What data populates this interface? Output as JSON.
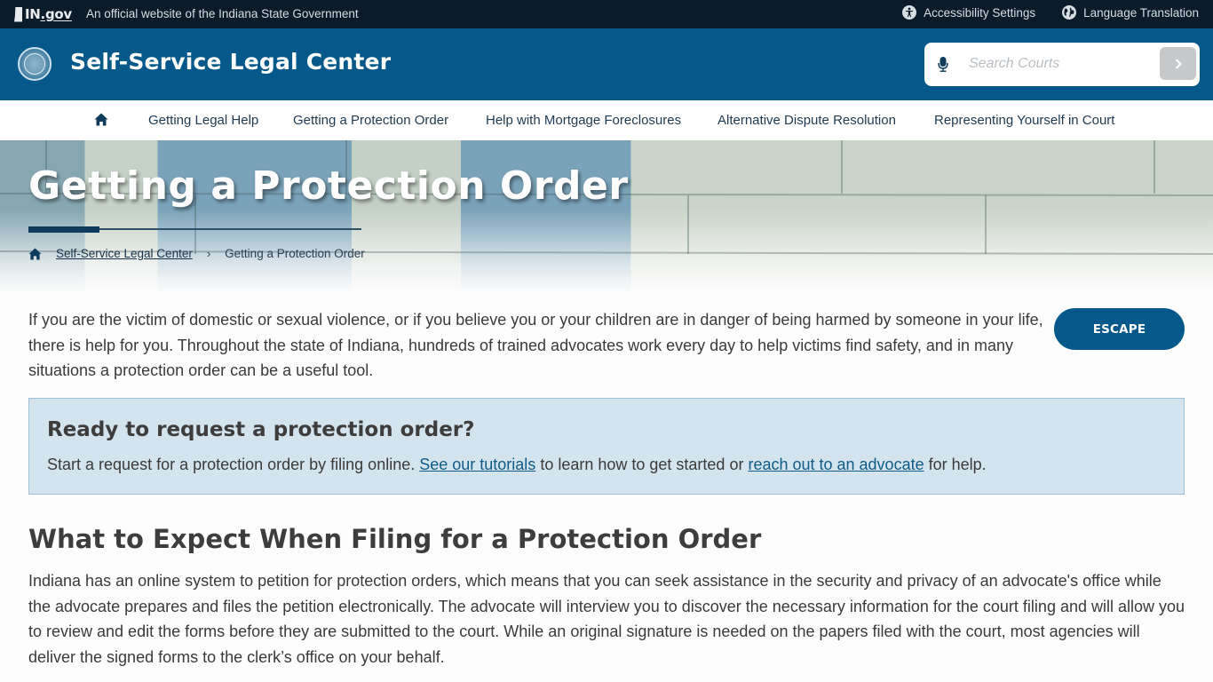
{
  "gov_bar": {
    "logo_text_in": "IN",
    "logo_text_gov": ".gov",
    "tagline": "An official website of the Indiana State Government",
    "accessibility_label": "Accessibility Settings",
    "language_label": "Language Translation"
  },
  "header": {
    "site_title": "Self-Service Legal Center",
    "search": {
      "placeholder": "Search Courts",
      "value": "",
      "submit_icon": "chevron-right"
    }
  },
  "nav": {
    "home_icon": "home",
    "items": [
      {
        "label": "Getting Legal Help"
      },
      {
        "label": "Getting a Protection Order"
      },
      {
        "label": "Help with Mortgage Foreclosures"
      },
      {
        "label": "Alternative Dispute Resolution"
      },
      {
        "label": "Representing Yourself in Court"
      }
    ]
  },
  "hero": {
    "title": "Getting a Protection Order",
    "breadcrumb": {
      "parent": "Self-Service Legal Center",
      "separator": "›",
      "current": "Getting a Protection Order"
    }
  },
  "intro": {
    "text": "If you are the victim of domestic or sexual violence, or if you believe you or your children are in danger of being harmed by someone in your life, there is help for you. Throughout the state of Indiana, hundreds of trained advocates work every day to help victims find safety, and in many situations a protection order can be a useful tool.",
    "escape_label": "ESCAPE"
  },
  "callout": {
    "heading": "Ready to request a protection order?",
    "text_before": "Start a request for a protection order by filing online. ",
    "link1": "See our tutorials",
    "text_middle": " to learn how to get started or ",
    "link2": "reach out to an advocate",
    "text_after": " for help."
  },
  "section": {
    "heading": "What to Expect When Filing for a Protection Order",
    "paragraph": "Indiana has an online system to petition for protection orders, which means that you can seek assistance in the security and privacy of an advocate's office while the advocate prepares and files the petition electronically. The advocate will interview you to discover the necessary information for the court filing and will allow you to review and edit the forms before they are submitted to the court. While an original signature is needed on the papers filed with the court, most agencies will deliver the signed forms to the clerk’s office on your behalf."
  },
  "colors": {
    "gov_bar_bg": "#0b1b2a",
    "brand_blue": "#05598a",
    "callout_bg": "#d3e4ef",
    "link": "#105a86",
    "heading_text": "#3d3d3d"
  }
}
